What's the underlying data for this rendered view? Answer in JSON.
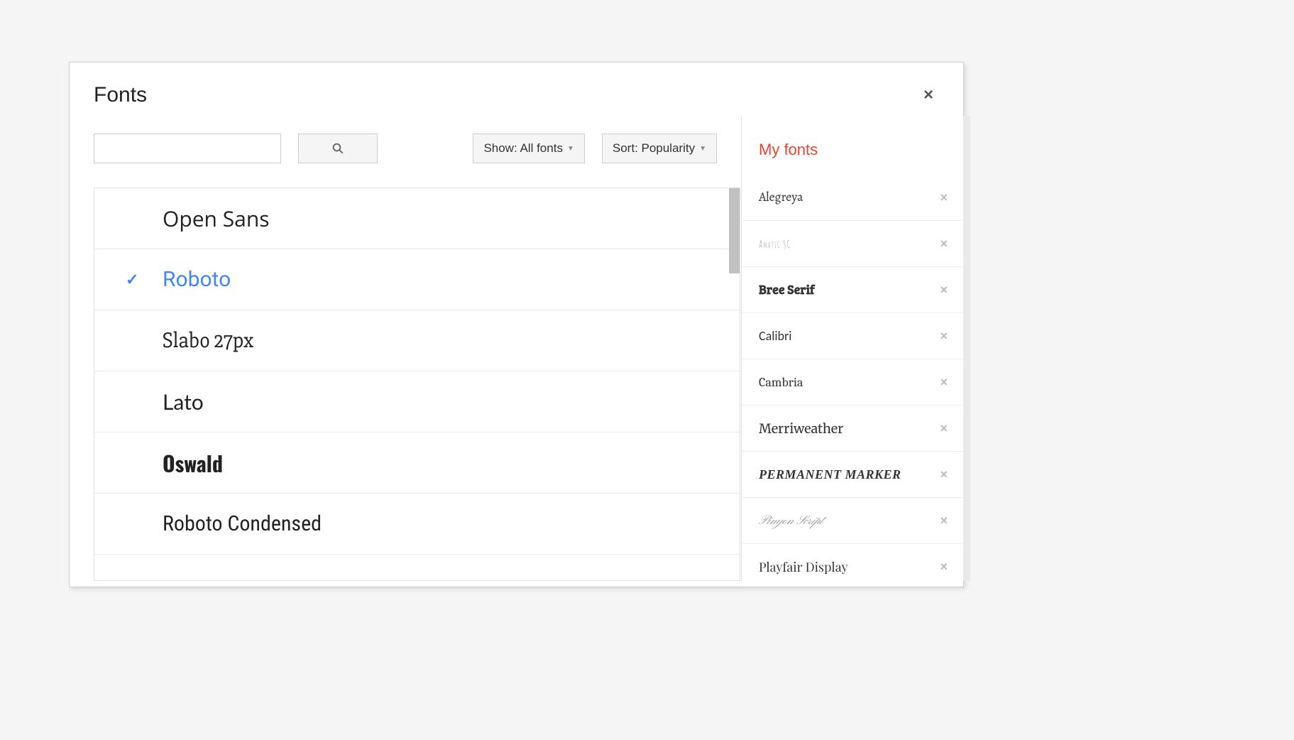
{
  "dialog": {
    "title": "Fonts"
  },
  "filter": {
    "show_label": "Show: All fonts",
    "sort_label": "Sort: Popularity"
  },
  "font_list": [
    {
      "name": "Open Sans",
      "selected": false,
      "css": "f-opensans"
    },
    {
      "name": "Roboto",
      "selected": true,
      "css": "f-roboto"
    },
    {
      "name": "Slabo 27px",
      "selected": false,
      "css": "f-slabo"
    },
    {
      "name": "Lato",
      "selected": false,
      "css": "f-lato"
    },
    {
      "name": "Oswald",
      "selected": false,
      "css": "f-oswald"
    },
    {
      "name": "Roboto Condensed",
      "selected": false,
      "css": "f-robotocond"
    }
  ],
  "my_fonts": {
    "title": "My fonts",
    "items": [
      {
        "name": "Alegreya",
        "css": "mf-alegreya"
      },
      {
        "name": "Amatic SC",
        "css": "mf-amatic"
      },
      {
        "name": "Bree Serif",
        "css": "mf-bree"
      },
      {
        "name": "Calibri",
        "css": "mf-calibri"
      },
      {
        "name": "Cambria",
        "css": "mf-cambria"
      },
      {
        "name": "Merriweather",
        "css": "mf-merri"
      },
      {
        "name": "Permanent Marker",
        "css": "mf-marker"
      },
      {
        "name": "Pinyon Script",
        "css": "mf-pinyon"
      },
      {
        "name": "Playfair Display",
        "css": "mf-playfair"
      }
    ]
  }
}
